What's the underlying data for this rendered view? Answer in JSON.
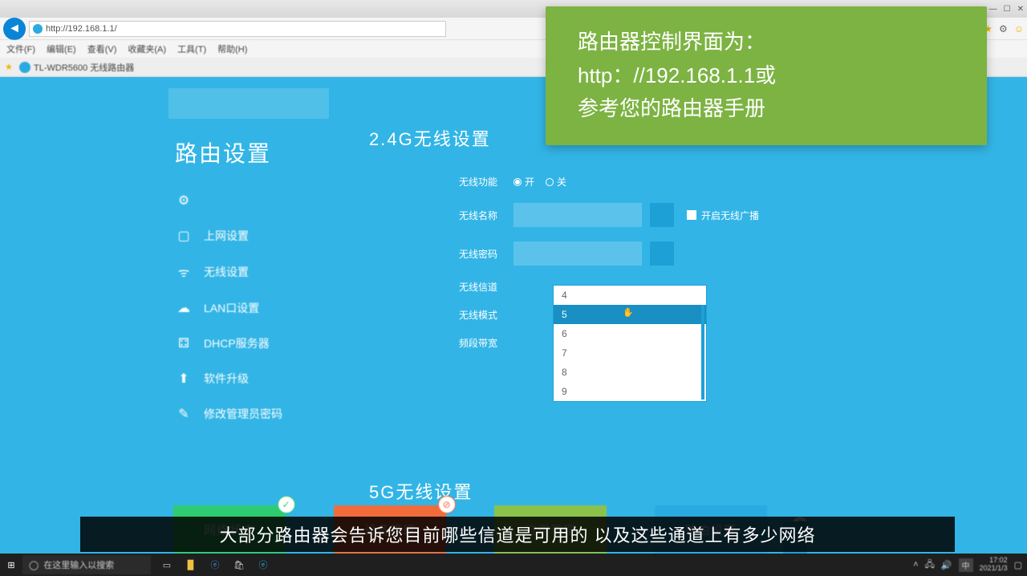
{
  "browser": {
    "url": "http://192.168.1.1/",
    "window_min": "—",
    "window_max": "☐",
    "window_close": "✕",
    "menus": [
      "文件(F)",
      "编辑(E)",
      "查看(V)",
      "收藏夹(A)",
      "工具(T)",
      "帮助(H)"
    ],
    "tab_title": "TL-WDR5600 无线路由器"
  },
  "sidebar": {
    "title": "路由设置",
    "items": [
      {
        "icon": "⚙",
        "label": ""
      },
      {
        "icon": "▢",
        "label": "上网设置"
      },
      {
        "icon": "ᯤ",
        "label": "无线设置"
      },
      {
        "icon": "☁",
        "label": "LAN口设置"
      },
      {
        "icon": "⚃",
        "label": "DHCP服务器"
      },
      {
        "icon": "⬆",
        "label": "软件升级"
      },
      {
        "icon": "✎",
        "label": "修改管理员密码"
      }
    ]
  },
  "content": {
    "section1_title": "2.4G无线设置",
    "section2_title": "5G无线设置",
    "rows": {
      "radio_label": "无线功能",
      "radio_on": "开",
      "radio_off": "关",
      "ssid_label": "无线名称",
      "ssid_chk": "开启无线广播",
      "pwd_label": "无线密码",
      "channel_label": "无线信道",
      "mode_label": "无线模式",
      "width_label": "频段带宽"
    },
    "dropdown_options": [
      "4",
      "5",
      "6",
      "7",
      "8",
      "9"
    ],
    "dropdown_selected": "5",
    "help": "?"
  },
  "tiles": [
    {
      "label": "网络状态",
      "cls": "t-green",
      "badge": "✓"
    },
    {
      "label": "设备管理",
      "cls": "t-orange",
      "badge": "⊘"
    },
    {
      "label": "应用管理",
      "cls": "t-olive",
      "badge": ""
    },
    {
      "label": "路由设置",
      "cls": "t-blue",
      "badge": ""
    }
  ],
  "callout": {
    "l1": "路由器控制界面为：",
    "l2": "http：//192.168.1.1或",
    "l3": "参考您的路由器手册"
  },
  "subtitle": "大部分路由器会告诉您目前哪些信道是可用的 以及这些通道上有多少网络",
  "taskbar": {
    "search_placeholder": "在这里输入以搜索",
    "lang": "中",
    "time": "17:02",
    "date": "2021/1/3"
  }
}
